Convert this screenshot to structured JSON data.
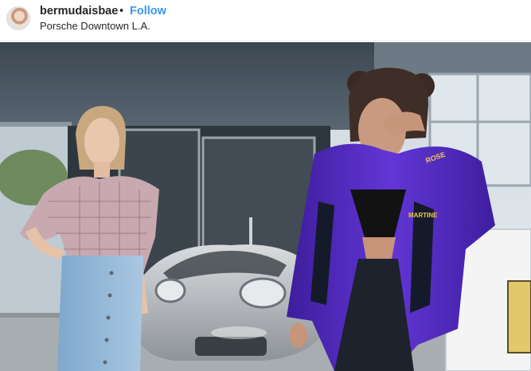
{
  "post": {
    "username": "bermudaisbae",
    "separator": "•",
    "follow_label": "Follow",
    "location": "Porsche Downtown L.A."
  },
  "photo": {
    "jacket_text": "MARTINE",
    "sleeve_text": "ROSE"
  },
  "colors": {
    "follow_blue": "#3897f0",
    "text_dark": "#262626",
    "jacket_purple": "#5b2fc7",
    "car_silver": "#b9bcc0"
  }
}
